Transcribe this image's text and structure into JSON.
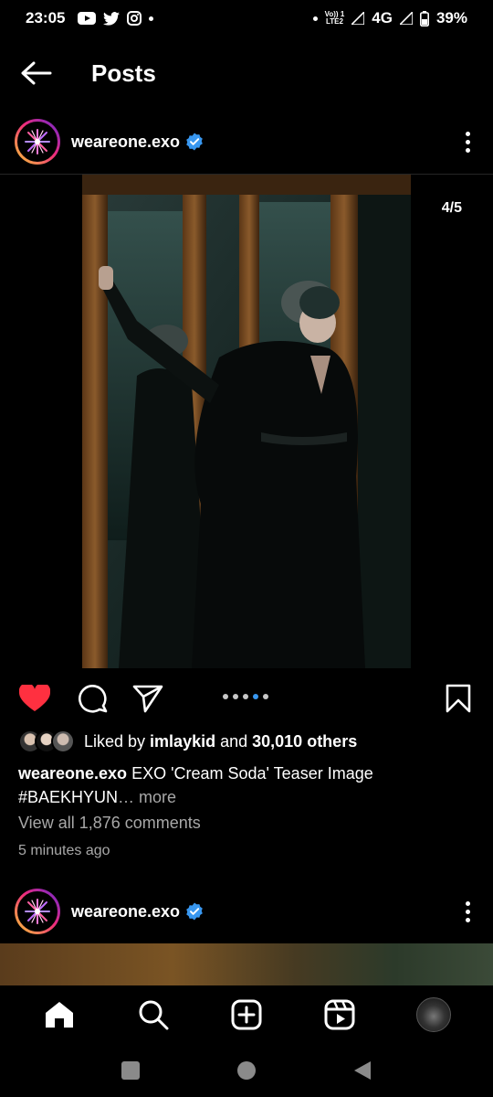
{
  "status_bar": {
    "time": "23:05",
    "volte_line1": "Vo)) 1",
    "volte_line2": "LTE2",
    "network": "4G",
    "battery": "39%",
    "icons": [
      "youtube-icon",
      "twitter-icon",
      "instagram-icon",
      "notification-dot-icon",
      "wifi-signal-icon",
      "cell-signal-icon",
      "battery-icon"
    ]
  },
  "header": {
    "title": "Posts",
    "back_icon": "arrow-left-icon"
  },
  "post": {
    "username": "weareone.exo",
    "verified": true,
    "media_counter": "4/5",
    "carousel": {
      "count": 5,
      "active_index": 3
    },
    "liked": true,
    "likes": {
      "prefix": "Liked by ",
      "user": "imlaykid",
      "connector": " and ",
      "others": "30,010 others"
    },
    "caption": {
      "username": "weareone.exo",
      "text": " EXO 'Cream Soda' Teaser Image",
      "hashtag": "#BAEKHYUN",
      "ellipsis": "…",
      "more": " more"
    },
    "view_comments": "View all 1,876 comments",
    "timestamp": "5 minutes ago"
  },
  "next_post": {
    "username": "weareone.exo",
    "verified": true
  },
  "bottom_nav": [
    "home-icon",
    "search-icon",
    "create-icon",
    "reels-icon",
    "profile-avatar"
  ],
  "colors": {
    "background": "#000000",
    "like_red": "#ff3040",
    "verified_blue": "#3897f0",
    "muted_text": "#a8a8a8"
  }
}
